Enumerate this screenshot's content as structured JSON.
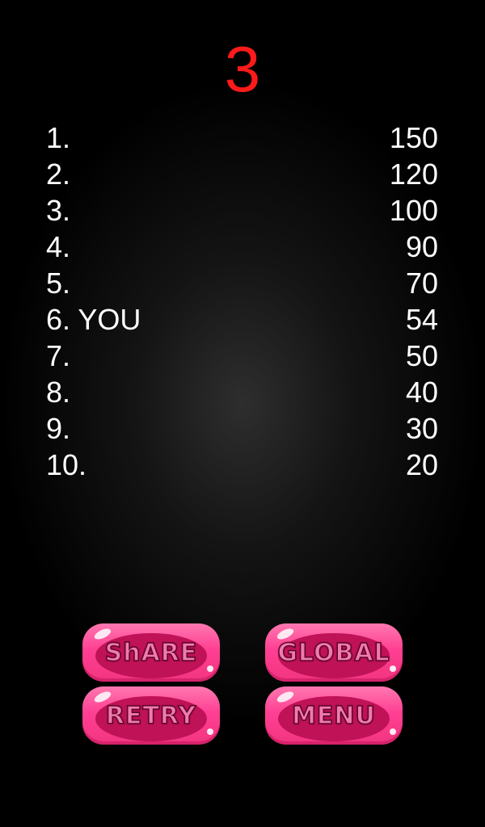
{
  "result": {
    "rank": "3"
  },
  "leaderboard": [
    {
      "rank_label": "1.",
      "score": "150"
    },
    {
      "rank_label": "2.",
      "score": "120"
    },
    {
      "rank_label": "3.",
      "score": "100"
    },
    {
      "rank_label": "4.",
      "score": "90"
    },
    {
      "rank_label": "5.",
      "score": "70"
    },
    {
      "rank_label": "6. YOU",
      "score": "54"
    },
    {
      "rank_label": "7.",
      "score": "50"
    },
    {
      "rank_label": "8.",
      "score": "40"
    },
    {
      "rank_label": "9.",
      "score": "30"
    },
    {
      "rank_label": "10.",
      "score": "20"
    }
  ],
  "buttons": {
    "share": "ShARE",
    "global": "GLOBAL",
    "retry": "RETRY",
    "menu": "MENU"
  },
  "colors": {
    "background": "#000000",
    "rank_number": "#ff1a1a",
    "list_text": "#ffffff",
    "button_pink": "#ff3f93",
    "button_inner": "#c01257"
  }
}
